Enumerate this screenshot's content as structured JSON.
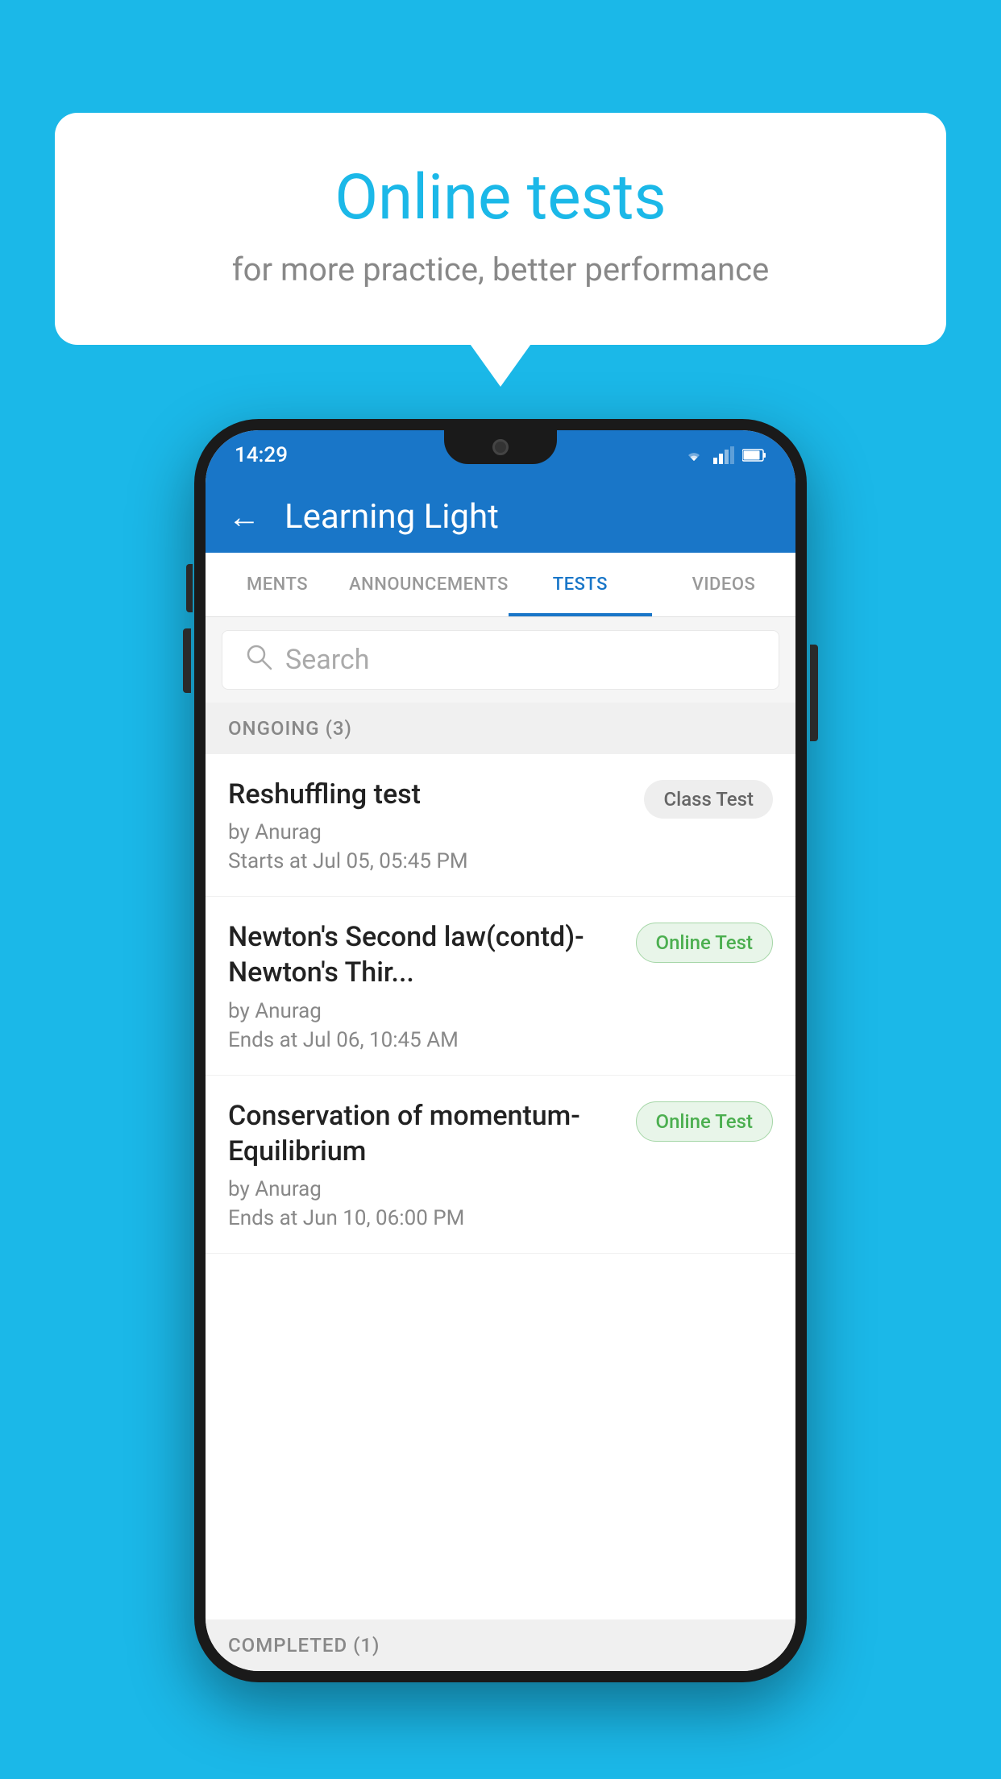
{
  "background_color": "#1bb8e8",
  "speech_bubble": {
    "title": "Online tests",
    "subtitle": "for more practice, better performance"
  },
  "phone": {
    "status_bar": {
      "time": "14:29"
    },
    "app_bar": {
      "back_label": "←",
      "title": "Learning Light"
    },
    "tabs": [
      {
        "id": "ments",
        "label": "MENTS",
        "active": false
      },
      {
        "id": "announcements",
        "label": "ANNOUNCEMENTS",
        "active": false
      },
      {
        "id": "tests",
        "label": "TESTS",
        "active": true
      },
      {
        "id": "videos",
        "label": "VIDEOS",
        "active": false
      }
    ],
    "search": {
      "placeholder": "Search"
    },
    "sections": [
      {
        "id": "ongoing",
        "label": "ONGOING (3)",
        "items": [
          {
            "name": "Reshuffling test",
            "by": "by Anurag",
            "date_label": "Starts at",
            "date": "Jul 05, 05:45 PM",
            "badge": "Class Test",
            "badge_type": "class"
          },
          {
            "name": "Newton's Second law(contd)-Newton's Thir...",
            "by": "by Anurag",
            "date_label": "Ends at",
            "date": "Jul 06, 10:45 AM",
            "badge": "Online Test",
            "badge_type": "online"
          },
          {
            "name": "Conservation of momentum-Equilibrium",
            "by": "by Anurag",
            "date_label": "Ends at",
            "date": "Jun 10, 06:00 PM",
            "badge": "Online Test",
            "badge_type": "online"
          }
        ]
      }
    ],
    "bottom_section_label": "COMPLETED (1)"
  }
}
